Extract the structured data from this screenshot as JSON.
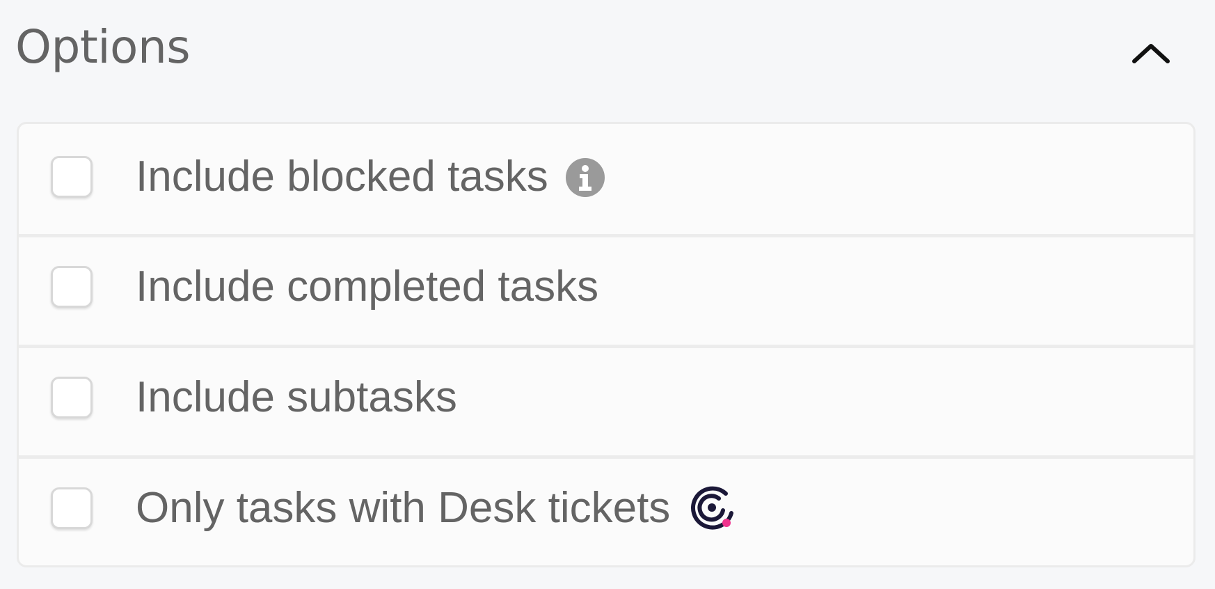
{
  "header": {
    "title": "Options",
    "collapse_icon": "chevron-up-icon"
  },
  "options": [
    {
      "label": "Include blocked tasks",
      "checked": false,
      "icon": "info-icon"
    },
    {
      "label": "Include completed tasks",
      "checked": false
    },
    {
      "label": "Include subtasks",
      "checked": false
    },
    {
      "label": "Only tasks with Desk tickets",
      "checked": false,
      "icon": "desk-logo-icon"
    }
  ],
  "colors": {
    "background": "#f6f7f9",
    "panel": "#fbfbfb",
    "text": "#646464",
    "info_icon": "#9a9a9a",
    "desk_dark": "#1b1838",
    "desk_accent": "#f0348e"
  }
}
